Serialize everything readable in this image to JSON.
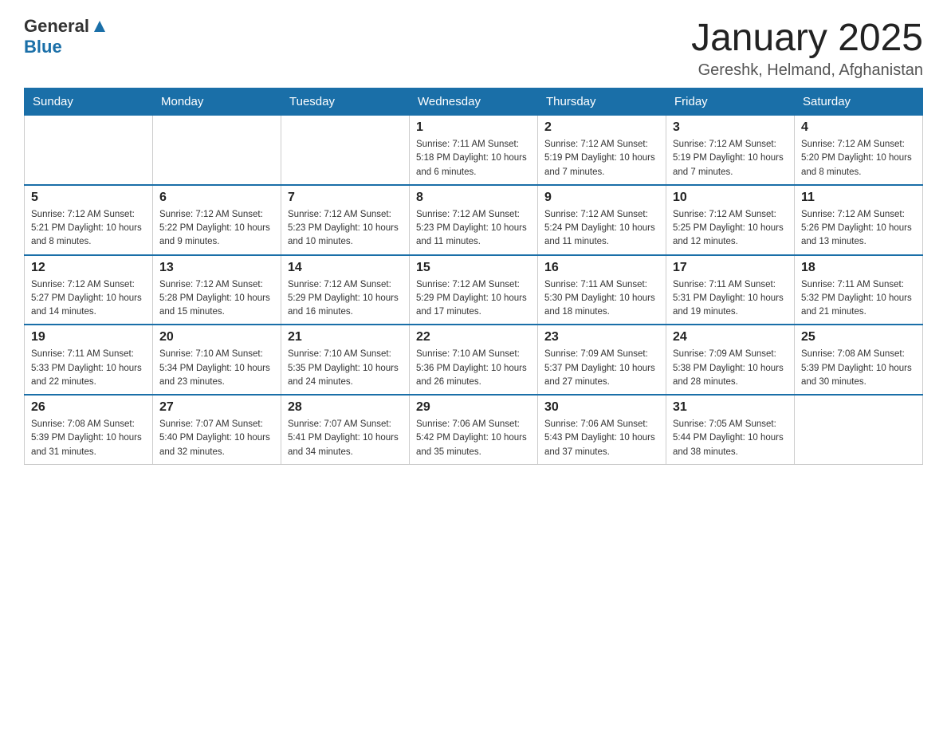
{
  "logo": {
    "text_general": "General",
    "text_blue": "Blue",
    "arrow": "▲"
  },
  "title": "January 2025",
  "subtitle": "Gereshk, Helmand, Afghanistan",
  "days_of_week": [
    "Sunday",
    "Monday",
    "Tuesday",
    "Wednesday",
    "Thursday",
    "Friday",
    "Saturday"
  ],
  "weeks": [
    [
      {
        "day": "",
        "info": ""
      },
      {
        "day": "",
        "info": ""
      },
      {
        "day": "",
        "info": ""
      },
      {
        "day": "1",
        "info": "Sunrise: 7:11 AM\nSunset: 5:18 PM\nDaylight: 10 hours and 6 minutes."
      },
      {
        "day": "2",
        "info": "Sunrise: 7:12 AM\nSunset: 5:19 PM\nDaylight: 10 hours and 7 minutes."
      },
      {
        "day": "3",
        "info": "Sunrise: 7:12 AM\nSunset: 5:19 PM\nDaylight: 10 hours and 7 minutes."
      },
      {
        "day": "4",
        "info": "Sunrise: 7:12 AM\nSunset: 5:20 PM\nDaylight: 10 hours and 8 minutes."
      }
    ],
    [
      {
        "day": "5",
        "info": "Sunrise: 7:12 AM\nSunset: 5:21 PM\nDaylight: 10 hours and 8 minutes."
      },
      {
        "day": "6",
        "info": "Sunrise: 7:12 AM\nSunset: 5:22 PM\nDaylight: 10 hours and 9 minutes."
      },
      {
        "day": "7",
        "info": "Sunrise: 7:12 AM\nSunset: 5:23 PM\nDaylight: 10 hours and 10 minutes."
      },
      {
        "day": "8",
        "info": "Sunrise: 7:12 AM\nSunset: 5:23 PM\nDaylight: 10 hours and 11 minutes."
      },
      {
        "day": "9",
        "info": "Sunrise: 7:12 AM\nSunset: 5:24 PM\nDaylight: 10 hours and 11 minutes."
      },
      {
        "day": "10",
        "info": "Sunrise: 7:12 AM\nSunset: 5:25 PM\nDaylight: 10 hours and 12 minutes."
      },
      {
        "day": "11",
        "info": "Sunrise: 7:12 AM\nSunset: 5:26 PM\nDaylight: 10 hours and 13 minutes."
      }
    ],
    [
      {
        "day": "12",
        "info": "Sunrise: 7:12 AM\nSunset: 5:27 PM\nDaylight: 10 hours and 14 minutes."
      },
      {
        "day": "13",
        "info": "Sunrise: 7:12 AM\nSunset: 5:28 PM\nDaylight: 10 hours and 15 minutes."
      },
      {
        "day": "14",
        "info": "Sunrise: 7:12 AM\nSunset: 5:29 PM\nDaylight: 10 hours and 16 minutes."
      },
      {
        "day": "15",
        "info": "Sunrise: 7:12 AM\nSunset: 5:29 PM\nDaylight: 10 hours and 17 minutes."
      },
      {
        "day": "16",
        "info": "Sunrise: 7:11 AM\nSunset: 5:30 PM\nDaylight: 10 hours and 18 minutes."
      },
      {
        "day": "17",
        "info": "Sunrise: 7:11 AM\nSunset: 5:31 PM\nDaylight: 10 hours and 19 minutes."
      },
      {
        "day": "18",
        "info": "Sunrise: 7:11 AM\nSunset: 5:32 PM\nDaylight: 10 hours and 21 minutes."
      }
    ],
    [
      {
        "day": "19",
        "info": "Sunrise: 7:11 AM\nSunset: 5:33 PM\nDaylight: 10 hours and 22 minutes."
      },
      {
        "day": "20",
        "info": "Sunrise: 7:10 AM\nSunset: 5:34 PM\nDaylight: 10 hours and 23 minutes."
      },
      {
        "day": "21",
        "info": "Sunrise: 7:10 AM\nSunset: 5:35 PM\nDaylight: 10 hours and 24 minutes."
      },
      {
        "day": "22",
        "info": "Sunrise: 7:10 AM\nSunset: 5:36 PM\nDaylight: 10 hours and 26 minutes."
      },
      {
        "day": "23",
        "info": "Sunrise: 7:09 AM\nSunset: 5:37 PM\nDaylight: 10 hours and 27 minutes."
      },
      {
        "day": "24",
        "info": "Sunrise: 7:09 AM\nSunset: 5:38 PM\nDaylight: 10 hours and 28 minutes."
      },
      {
        "day": "25",
        "info": "Sunrise: 7:08 AM\nSunset: 5:39 PM\nDaylight: 10 hours and 30 minutes."
      }
    ],
    [
      {
        "day": "26",
        "info": "Sunrise: 7:08 AM\nSunset: 5:39 PM\nDaylight: 10 hours and 31 minutes."
      },
      {
        "day": "27",
        "info": "Sunrise: 7:07 AM\nSunset: 5:40 PM\nDaylight: 10 hours and 32 minutes."
      },
      {
        "day": "28",
        "info": "Sunrise: 7:07 AM\nSunset: 5:41 PM\nDaylight: 10 hours and 34 minutes."
      },
      {
        "day": "29",
        "info": "Sunrise: 7:06 AM\nSunset: 5:42 PM\nDaylight: 10 hours and 35 minutes."
      },
      {
        "day": "30",
        "info": "Sunrise: 7:06 AM\nSunset: 5:43 PM\nDaylight: 10 hours and 37 minutes."
      },
      {
        "day": "31",
        "info": "Sunrise: 7:05 AM\nSunset: 5:44 PM\nDaylight: 10 hours and 38 minutes."
      },
      {
        "day": "",
        "info": ""
      }
    ]
  ]
}
